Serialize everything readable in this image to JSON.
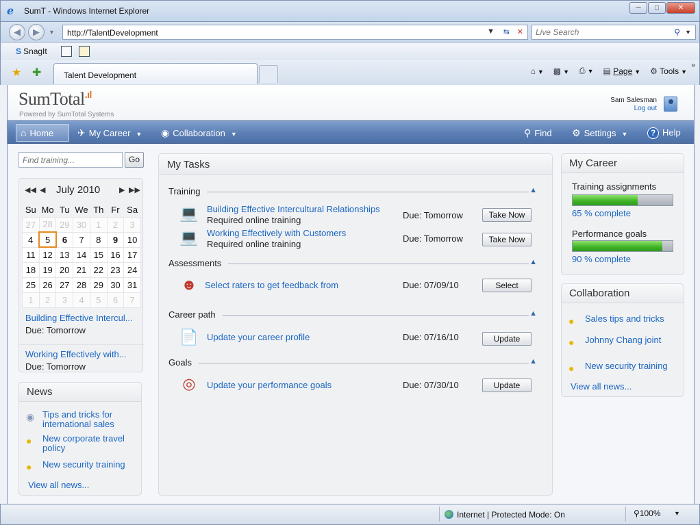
{
  "window": {
    "title": "SumT  - Windows Internet Explorer",
    "url": "http://TalentDevelopment",
    "search_placeholder": "Live Search"
  },
  "linksbar": {
    "snagit": "SnagIt"
  },
  "tab": {
    "label": "Talent Development"
  },
  "commandbar": {
    "page": "Page",
    "tools": "Tools"
  },
  "brand": {
    "logo": "SumTotal",
    "powered": "Powered by SumTotal Systems",
    "user_name": "Sam Salesman",
    "logout": "Log out"
  },
  "nav": {
    "home": "Home",
    "career": "My Career",
    "collaboration": "Collaboration",
    "find": "Find",
    "settings": "Settings",
    "help": "Help"
  },
  "search": {
    "placeholder": "Find training...",
    "go": "Go"
  },
  "calendar": {
    "month": "July 2010",
    "weekdays": [
      "Su",
      "Mo",
      "Tu",
      "We",
      "Th",
      "Fr",
      "Sa"
    ],
    "weeks": [
      [
        "27",
        "28",
        "29",
        "30",
        "1",
        "2",
        "3"
      ],
      [
        "4",
        "5",
        "6",
        "7",
        "8",
        "9",
        "10"
      ],
      [
        "11",
        "12",
        "13",
        "14",
        "15",
        "16",
        "17"
      ],
      [
        "18",
        "19",
        "20",
        "21",
        "22",
        "23",
        "24"
      ],
      [
        "25",
        "26",
        "27",
        "28",
        "29",
        "30",
        "31"
      ],
      [
        "1",
        "2",
        "3",
        "4",
        "5",
        "6",
        "7"
      ]
    ],
    "events": [
      {
        "title": "Building Effective Intercul...",
        "due": "Due: Tomorrow"
      },
      {
        "title": "Working Effectively with...",
        "due": "Due: Tomorrow"
      }
    ]
  },
  "news": {
    "title": "News",
    "items": [
      {
        "line1": "Tips and tricks for",
        "line2": "international sales"
      },
      {
        "line1": "New corporate travel",
        "line2": "policy"
      },
      {
        "line1": "New security training",
        "line2": ""
      }
    ],
    "view_all": "View all news..."
  },
  "tasks": {
    "title": "My Tasks",
    "sections": {
      "training": "Training",
      "assessments": "Assessments",
      "career_path": "Career path",
      "goals": "Goals"
    },
    "items": [
      {
        "title": "Building Effective Intercultural Relationships",
        "sub": "Required online training",
        "due": "Due: Tomorrow",
        "action": "Take Now"
      },
      {
        "title": "Working Effectively with Customers",
        "sub": "Required online training",
        "due": "Due: Tomorrow",
        "action": "Take Now"
      },
      {
        "title": "Select raters to get feedback from",
        "sub": "",
        "due": "Due: 07/09/10",
        "action": "Select"
      },
      {
        "title": "Update your career profile",
        "sub": "",
        "due": "Due: 07/16/10",
        "action": "Update"
      },
      {
        "title": "Update your performance goals",
        "sub": "",
        "due": "Due: 07/30/10",
        "action": "Update"
      }
    ]
  },
  "career": {
    "title": "My Career",
    "training_label": "Training assignments",
    "training_pct": 65,
    "training_text": "65 % complete",
    "goals_label": "Performance goals",
    "goals_pct": 90,
    "goals_text": "90 % complete"
  },
  "collaboration": {
    "title": "Collaboration",
    "items": [
      "Sales tips and tricks",
      "Johnny Chang joint",
      "New security training"
    ],
    "view_all": "View all news..."
  },
  "statusbar": {
    "zone": "Internet | Protected Mode: On",
    "zoom": "100%"
  },
  "colors": {
    "accent": "#1a66c2",
    "nav": "#5b7eb4",
    "progress": "#3fb125",
    "today": "#e68a1e"
  }
}
